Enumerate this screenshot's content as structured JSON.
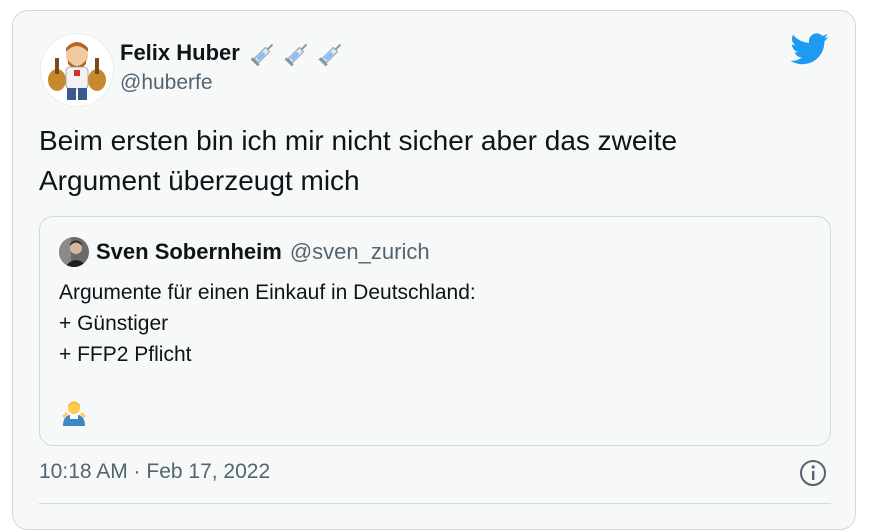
{
  "author": {
    "display_name": "Felix Huber",
    "handle": "@huberfe",
    "name_emojis": [
      "syringe-icon",
      "syringe-icon",
      "syringe-icon"
    ]
  },
  "tweet": {
    "text": "Beim ersten bin ich mir nicht sicher aber das zweite\nArgument überzeugt mich"
  },
  "quoted_tweet": {
    "display_name": "Sven Sobernheim",
    "handle": "@sven_zurich",
    "text": "Argumente für einen Einkauf in Deutschland:\n+ Günstiger\n+ FFP2 Pflicht",
    "emoji": "person-shrugging-icon"
  },
  "meta": {
    "timestamp": "10:18 AM · Feb 17, 2022"
  },
  "colors": {
    "twitter_blue": "#1d9bf0",
    "secondary_text": "#536471",
    "border": "#cfd9de",
    "card_bg": "#f7f9f9"
  }
}
